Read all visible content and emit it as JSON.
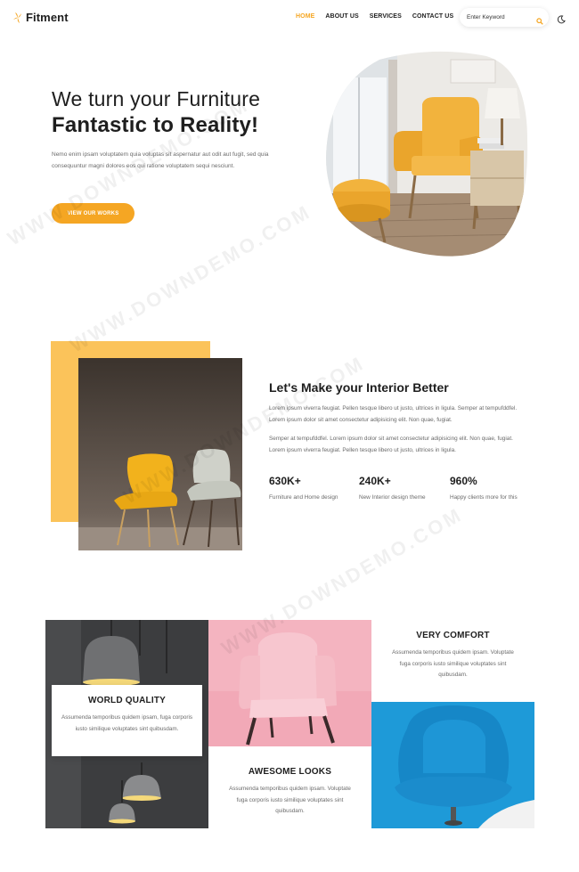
{
  "header": {
    "logo_text": "Fitment",
    "nav": [
      {
        "label": "HOME",
        "active": true
      },
      {
        "label": "ABOUT US",
        "active": false
      },
      {
        "label": "SERVICES",
        "active": false
      },
      {
        "label": "CONTACT US",
        "active": false
      }
    ],
    "search_placeholder": "Enter Keyword",
    "icons": {
      "search": "search-icon",
      "theme": "moon-icon"
    }
  },
  "hero": {
    "title_line1": "We turn your Furniture",
    "title_line2": "Fantastic to Reality!",
    "text": "Nemo enim ipsam voluptatem quia voluptas sit aspernatur aut odit aut fugit, sed quia consequuntur magni dolores eos qui ratione voluptatem sequi nesciunt.",
    "button_label": "VIEW OUR WORKS"
  },
  "about": {
    "title": "Let's Make your Interior Better",
    "paragraph1": "Lorem ipsum viverra feugiat. Pellen tesque libero ut justo, ultrices in ligula. Semper at tempufddfel. Lorem ipsum dolor sit amet consectetur adipisicing elit. Non quae, fugiat.",
    "paragraph2": "Semper at tempufddfel. Lorem ipsum dolor sit amet consectetur adipisicing elit. Non quae, fugiat. Lorem ipsum viverra feugiat. Pellen tesque libero ut justo, ultrices in ligula.",
    "stats": [
      {
        "value": "630K+",
        "label": "Furniture and Home design"
      },
      {
        "value": "240K+",
        "label": "New Interior design theme"
      },
      {
        "value": "960%",
        "label": "Happy clients more for this"
      }
    ]
  },
  "features": [
    {
      "title": "WORLD QUALITY",
      "text": "Assumenda temporibus quidem ipsam, fuga corporis iusto similique voluptates sint quibusdam."
    },
    {
      "title": "AWESOME LOOKS",
      "text": "Assumenda temporibus quidem ipsam. Voluptate fuga corporis iusto similique voluptates sint quibusdam."
    },
    {
      "title": "VERY COMFORT",
      "text": "Assumenda temporibus quidem ipsam. Voluptate fuga corporis iusto similique voluptates sint quibusdam."
    }
  ],
  "watermark": "WWW.DOWNDEMO.COM",
  "colors": {
    "accent": "#f5a623",
    "accent_light": "#fbc35a",
    "text_dark": "#1e1e1e",
    "text_muted": "#6b6b6b",
    "pink_bg": "#f4b4c0",
    "blue_bg": "#1e9ad8",
    "dark_gray": "#3c3d3f"
  }
}
